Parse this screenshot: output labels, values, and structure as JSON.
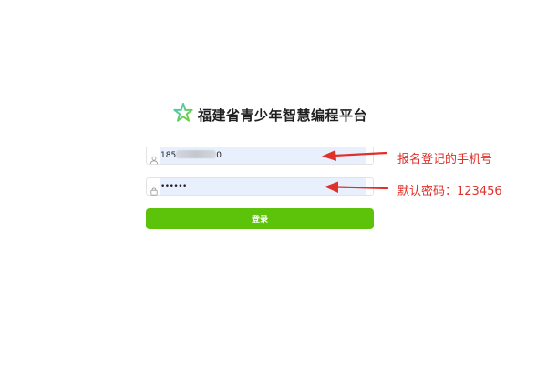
{
  "brand": {
    "logo": "star-logo-icon",
    "title": "福建省青少年智慧编程平台"
  },
  "form": {
    "phone": {
      "icon": "user-icon",
      "value_prefix": "185",
      "value_suffix": "0"
    },
    "password": {
      "icon": "lock-icon",
      "value": "••••••"
    },
    "login_label": "登录"
  },
  "annotations": {
    "phone_note": "报名登记的手机号",
    "password_note": "默认密码：123456"
  },
  "colors": {
    "accent_green": "#5cc30a",
    "annotation_red": "#e0302a",
    "autofill_blue": "#e8f0fe"
  }
}
